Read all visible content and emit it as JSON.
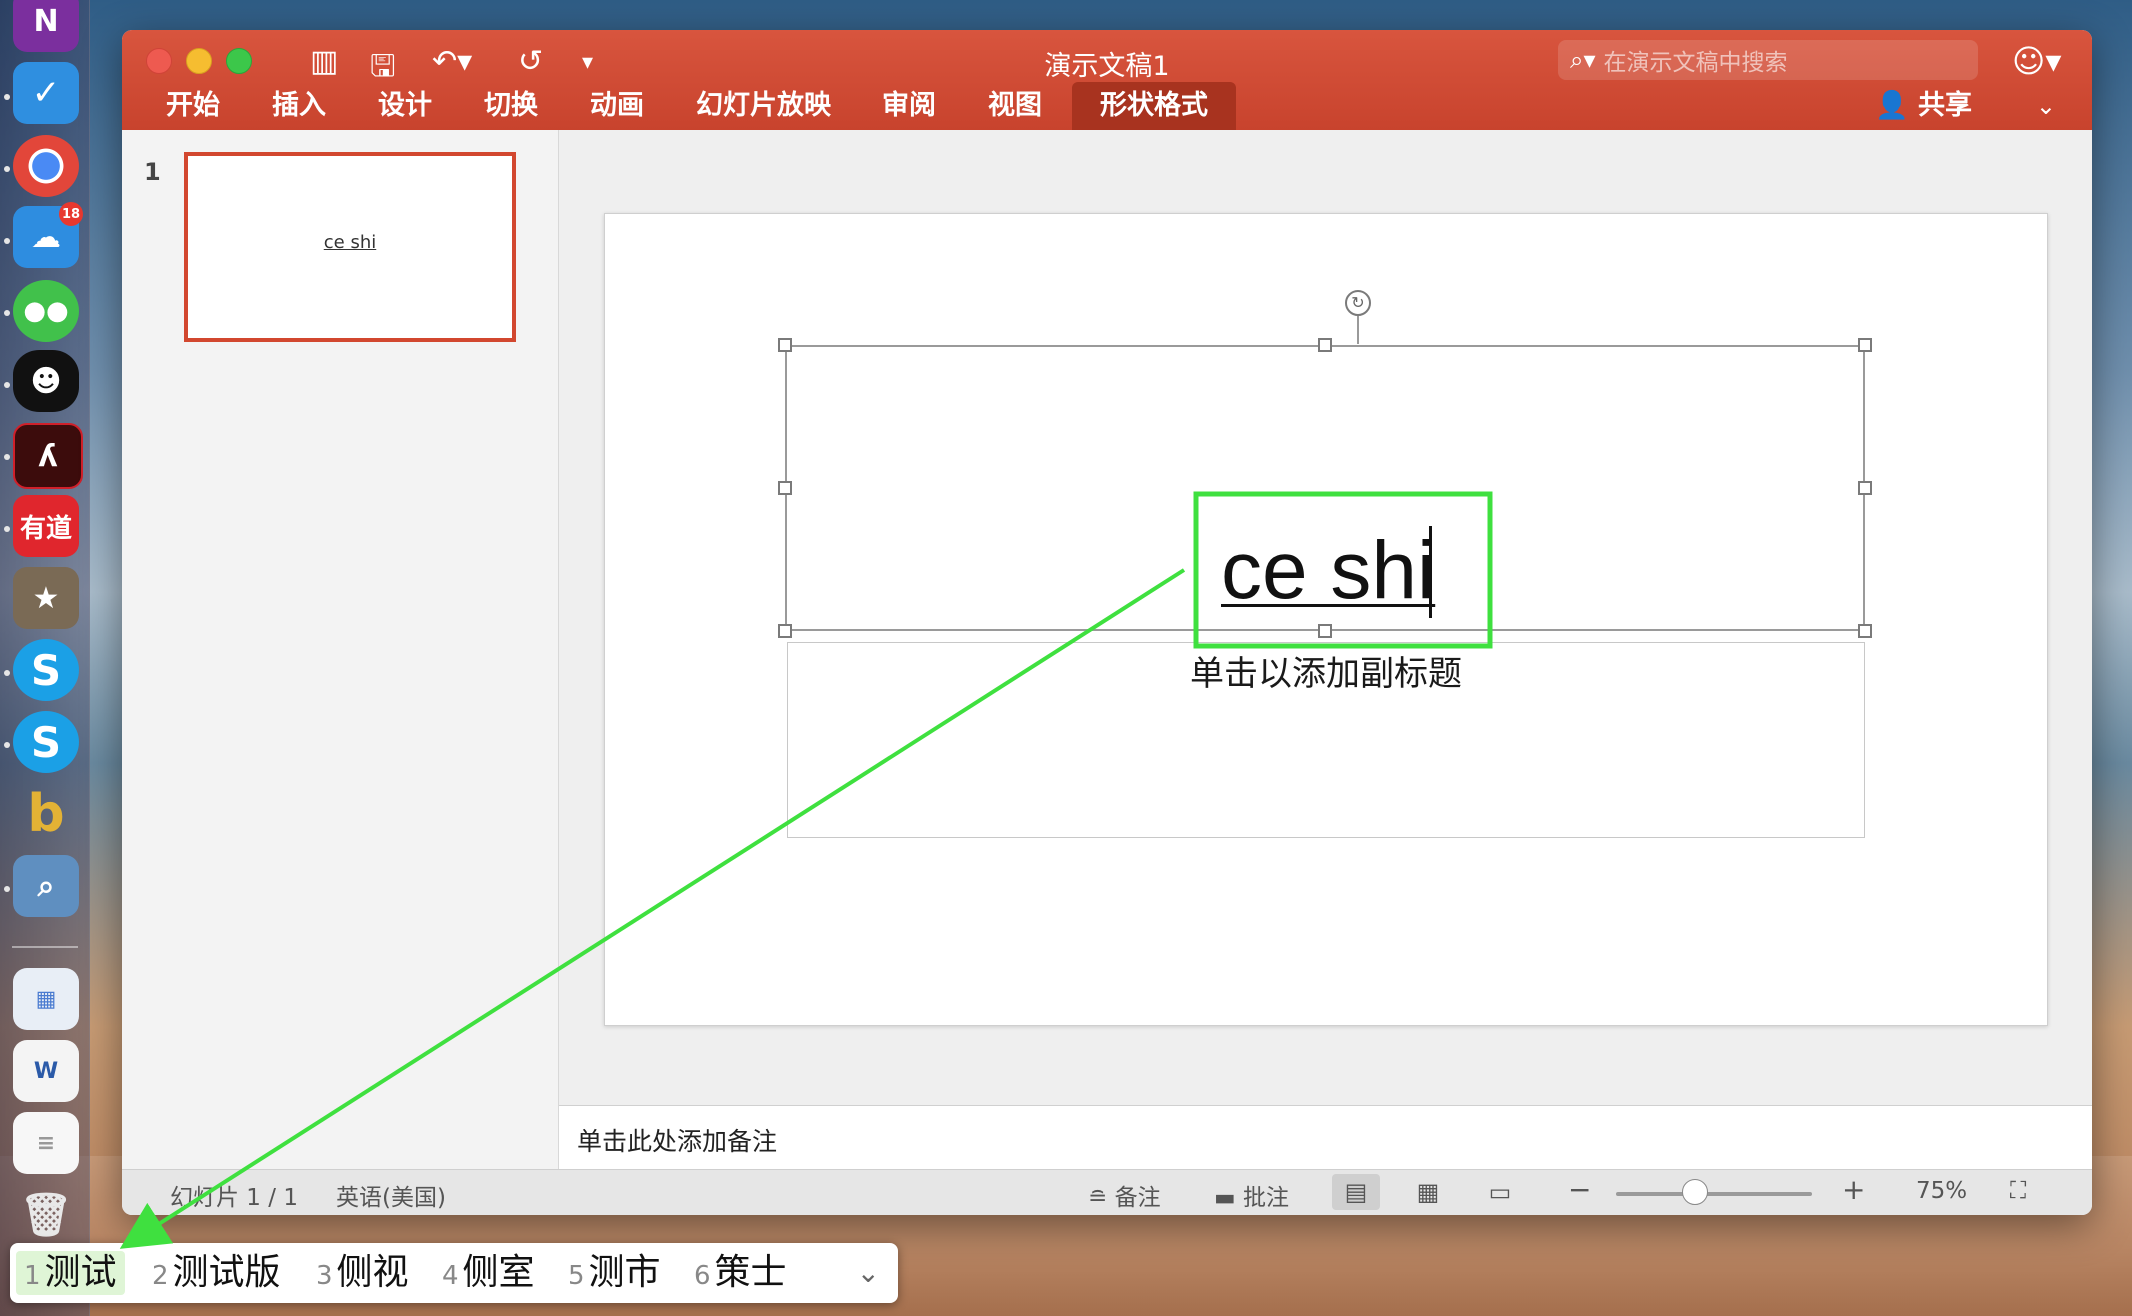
{
  "window": {
    "title": "演示文稿1",
    "search_placeholder": "在演示文稿中搜索",
    "share_label": "共享",
    "tabs": [
      "开始",
      "插入",
      "设计",
      "切换",
      "动画",
      "幻灯片放映",
      "审阅",
      "视图",
      "形状格式"
    ],
    "active_tab": "形状格式"
  },
  "thumbnails": [
    {
      "number": "1",
      "text": "ce shi"
    }
  ],
  "slide": {
    "title": "ce shi",
    "subtitle_placeholder": "单击以添加副标题"
  },
  "notes": {
    "placeholder": "单击此处添加备注"
  },
  "statusbar": {
    "slide_info": "幻灯片 1 / 1",
    "language": "英语(美国)",
    "notes_label": "备注",
    "comments_label": "批注",
    "zoom_out": "−",
    "zoom_in": "+",
    "zoom": "75%",
    "zoom_level": 0.35
  },
  "ime": {
    "candidates": [
      {
        "num": "1",
        "text": "测试"
      },
      {
        "num": "2",
        "text": "测试版"
      },
      {
        "num": "3",
        "text": "侧视"
      },
      {
        "num": "4",
        "text": "侧室"
      },
      {
        "num": "5",
        "text": "测市"
      },
      {
        "num": "6",
        "text": "策士"
      }
    ],
    "selected_index": 0
  },
  "dock": {
    "badge_count": "18",
    "youdao_label": "有道"
  },
  "colors": {
    "ribbon": "#c8432d",
    "active_tab": "#a8331f",
    "annotation": "#3fe03f",
    "thumb_border": "#d2472f"
  }
}
